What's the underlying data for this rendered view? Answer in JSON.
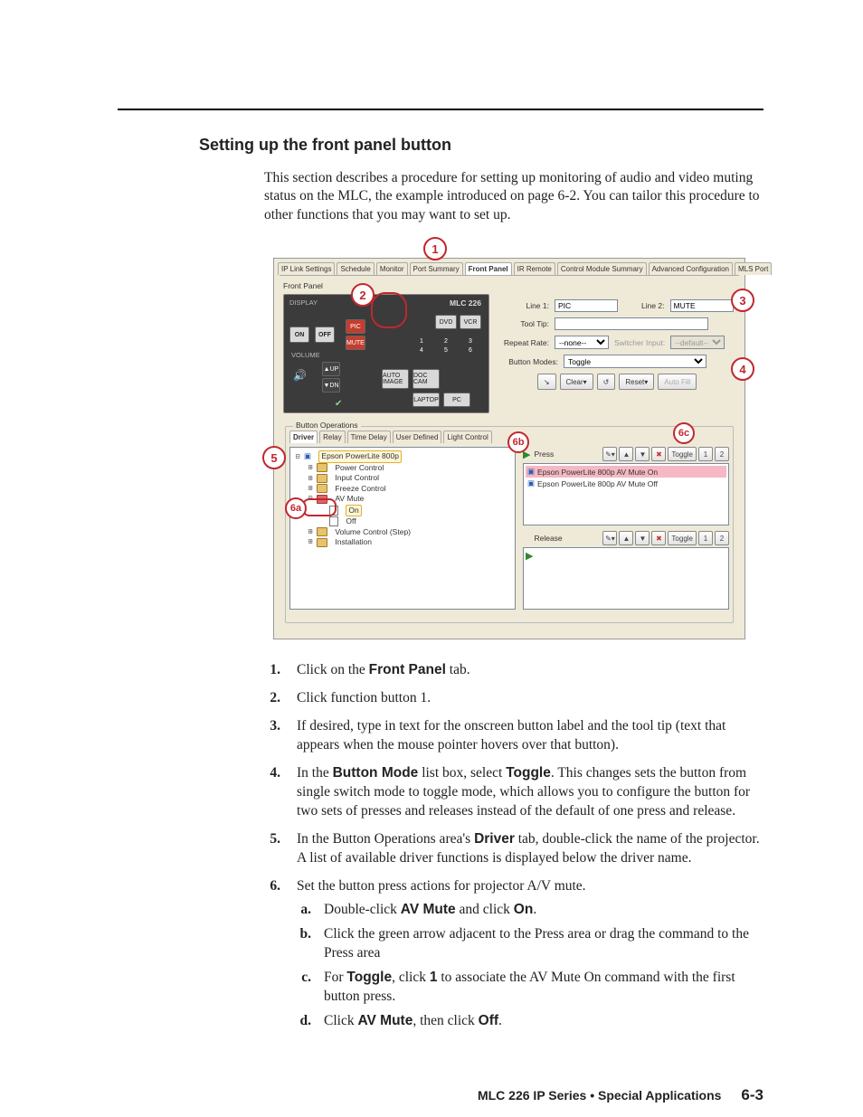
{
  "section_title": "Setting up the front panel button",
  "intro": "This section describes a procedure for setting up monitoring of audio and video muting status on the MLC, the example introduced on page 6-2.  You can tailor this procedure to other functions that you may want to set up.",
  "screenshot": {
    "tabs": [
      "IP Link Settings",
      "Schedule",
      "Monitor",
      "Port Summary",
      "Front Panel",
      "IR Remote",
      "Control Module Summary",
      "Advanced Configuration",
      "MLS Port"
    ],
    "active_tab": "Front Panel",
    "frontpanel_label": "Front Panel",
    "mlc": {
      "title": "MLC 226",
      "display_label": "DISPLAY",
      "on": "ON",
      "off": "OFF",
      "pic": "PIC",
      "mute": "MUTE",
      "dvd": "DVD",
      "vcr": "VCR",
      "nums": [
        "1",
        "2",
        "3",
        "4",
        "5",
        "6"
      ],
      "volume_label": "VOLUME",
      "up": "UP",
      "dn": "DN",
      "auto_image": "AUTO IMAGE",
      "doc_cam": "DOC CAM",
      "laptop": "LAPTOP",
      "pc": "PC"
    },
    "props": {
      "line1_label": "Line 1:",
      "line1_value": "PIC",
      "line2_label": "Line 2:",
      "line2_value": "MUTE",
      "tooltip_label": "Tool Tip:",
      "tooltip_value": "",
      "repeat_label": "Repeat Rate:",
      "repeat_value": "--none--",
      "switcher_label": "Switcher Input:",
      "switcher_value": "--default--",
      "mode_label": "Button Modes:",
      "mode_value": "Toggle",
      "clear": "Clear",
      "reset": "Reset",
      "autofill": "Auto Fill"
    },
    "ops": {
      "group_label": "Button Operations",
      "tabs": [
        "Driver",
        "Relay",
        "Time Delay",
        "User Defined",
        "Light Control"
      ],
      "tree": {
        "root": "Epson PowerLite 800p",
        "items": [
          "Power Control",
          "Input Control",
          "Freeze Control"
        ],
        "avmute": "AV Mute",
        "on": "On",
        "off": "Off",
        "vol": "Volume Control (Step)",
        "install": "Installation"
      },
      "press": "Press",
      "release": "Release",
      "toggle": "Toggle",
      "cmds": [
        "Epson PowerLite 800p AV Mute On",
        "Epson PowerLite 800p AV Mute Off"
      ]
    },
    "callouts": {
      "c1": "1",
      "c2": "2",
      "c3": "3",
      "c4": "4",
      "c5": "5",
      "c6a": "6a",
      "c6b": "6b",
      "c6c": "6c"
    }
  },
  "steps": [
    {
      "n": "1.",
      "pre": "Click on the ",
      "b": "Front Panel",
      "post": " tab."
    },
    {
      "n": "2.",
      "text": "Click function button 1."
    },
    {
      "n": "3.",
      "text": "If desired, type in text for the onscreen button label and the tool tip (text that appears when the mouse pointer hovers over that button)."
    },
    {
      "n": "4.",
      "pre": "In the ",
      "b": "Button Mode",
      "mid": " list box, select ",
      "b2": "Toggle",
      "post": ".  This changes sets the button from single switch mode to toggle mode, which allows you to configure the button for two sets of presses and releases instead of the default of one press and release."
    },
    {
      "n": "5.",
      "pre": "In the Button Operations area's ",
      "b": "Driver",
      "post": " tab, double-click the name of the projector.  A list of available driver functions is displayed below the driver name."
    },
    {
      "n": "6.",
      "text": "Set the button press actions for projector A/V mute.",
      "subs": [
        {
          "l": "a.",
          "pre": "Double-click ",
          "b": "AV Mute",
          "mid": " and click ",
          "b2": "On",
          "post": "."
        },
        {
          "l": "b.",
          "text": "Click the green arrow adjacent to the Press area or drag the command to the Press area"
        },
        {
          "l": "c.",
          "pre": "For ",
          "b": "Toggle",
          "mid": ", click ",
          "b2": "1",
          "post": " to associate the AV Mute On command with the first button press."
        },
        {
          "l": "d.",
          "pre": "Click ",
          "b": "AV Mute",
          "mid": ", then click ",
          "b2": "Off",
          "post": "."
        }
      ]
    }
  ],
  "footer": {
    "title": "MLC 226 IP Series • Special Applications",
    "page": "6-3"
  }
}
